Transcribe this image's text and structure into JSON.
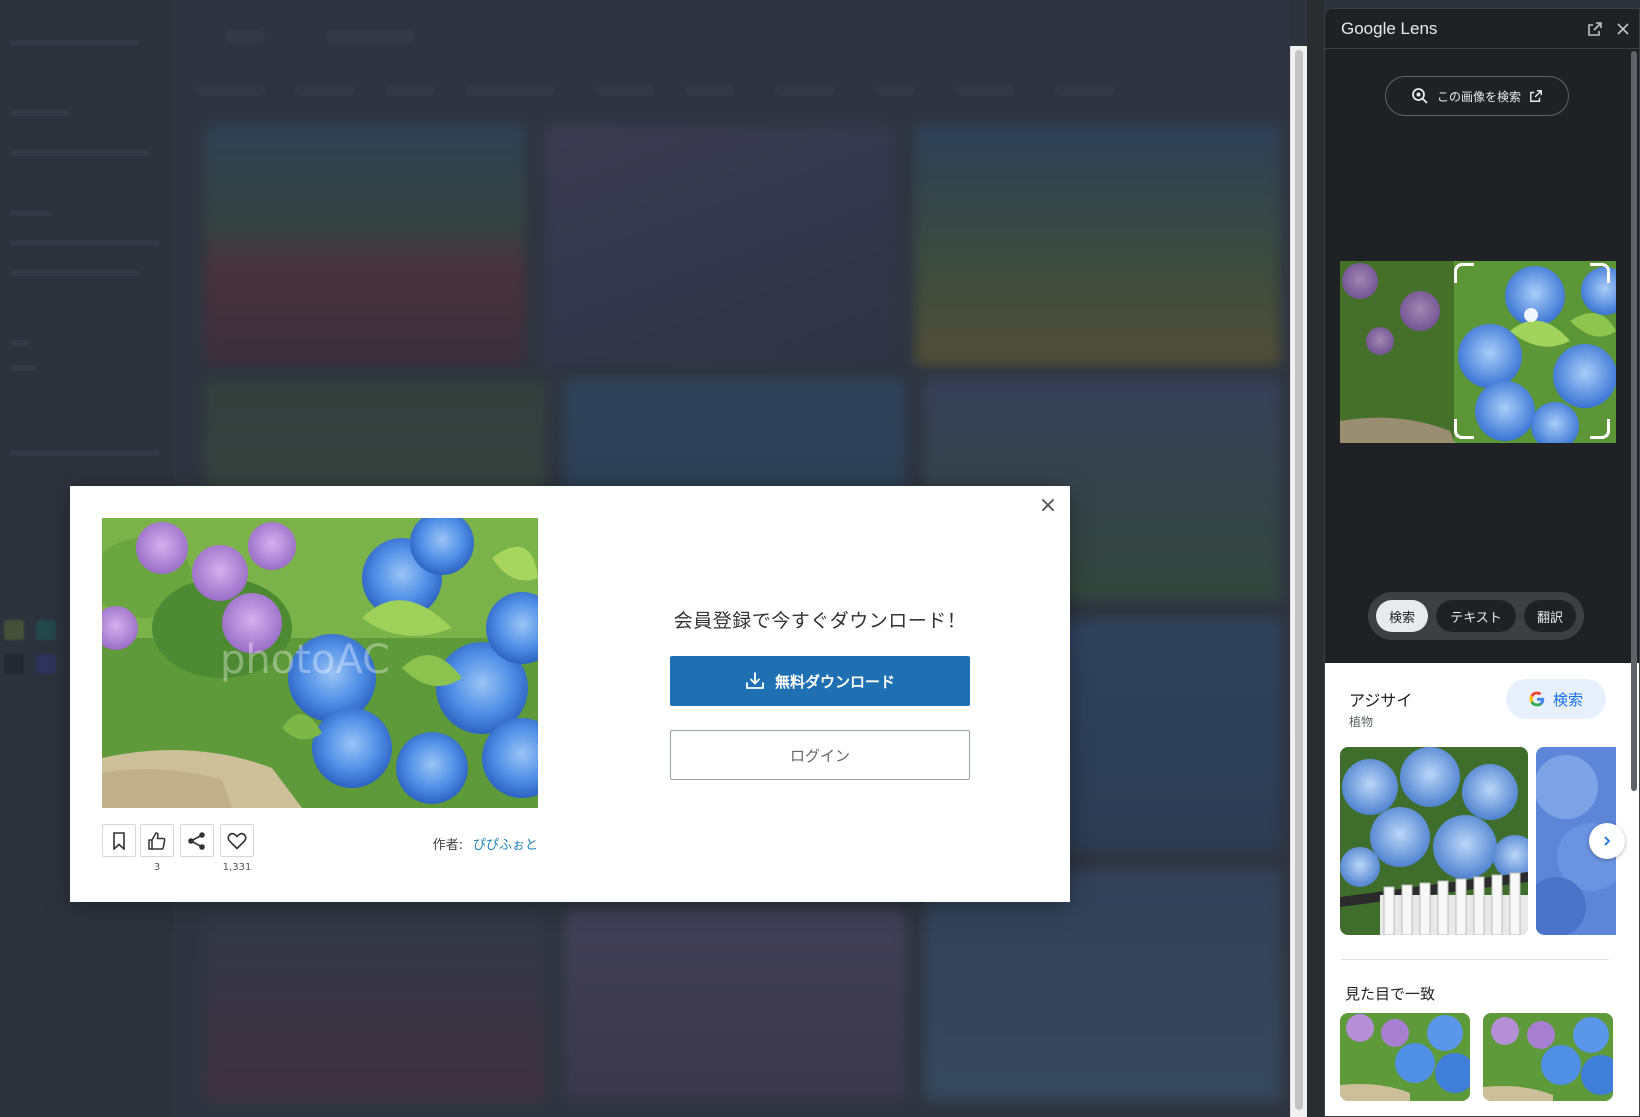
{
  "modal": {
    "cta_title": "会員登録で今すぐダウンロード！",
    "download_label": "無料ダウンロード",
    "login_label": "ログイン",
    "close_label": "×",
    "like_count": "3",
    "favorite_count": "1,331",
    "author_label": "作者:",
    "author_name": "ぴぴふぉと",
    "watermark": "photoAC"
  },
  "lens": {
    "title": "Google Lens",
    "search_image_label": "この画像を検索",
    "modes": [
      "検索",
      "テキスト",
      "翻訳"
    ],
    "entity_name": "アジサイ",
    "entity_category": "植物",
    "google_search_label": "検索",
    "visual_matches_title": "見た目で一致"
  },
  "icons": {
    "close": "close-icon",
    "download": "download-icon",
    "bookmark": "bookmark-icon",
    "thumbs_up": "thumbs-up-icon",
    "share": "share-icon",
    "heart": "heart-icon",
    "open_new": "open-in-new-icon",
    "lens": "lens-search-icon",
    "chevron_right": "chevron-right-icon"
  },
  "colors": {
    "download_button": "#1f6fb3",
    "author_link": "#1c82b9",
    "lens_background": "#202124",
    "google_blue": "#1a73e8"
  }
}
